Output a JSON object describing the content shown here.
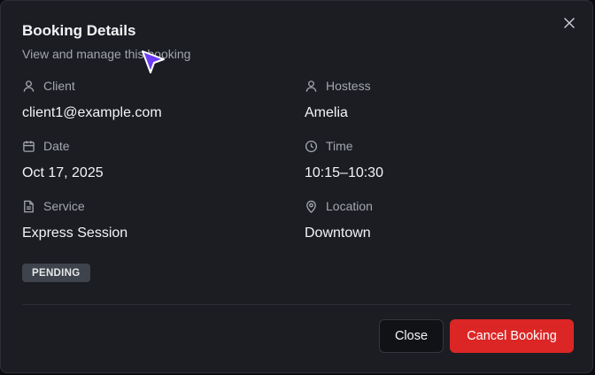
{
  "dialog": {
    "title": "Booking Details",
    "subtitle": "View and manage this booking",
    "close_icon": "x-icon"
  },
  "fields": {
    "client": {
      "label": "Client",
      "value": "client1@example.com",
      "icon": "user-icon"
    },
    "hostess": {
      "label": "Hostess",
      "value": "Amelia",
      "icon": "user-icon"
    },
    "date": {
      "label": "Date",
      "value": "Oct 17, 2025",
      "icon": "calendar-icon"
    },
    "time": {
      "label": "Time",
      "value": "10:15–10:30",
      "icon": "clock-icon"
    },
    "service": {
      "label": "Service",
      "value": "Express Session",
      "icon": "file-text-icon"
    },
    "location": {
      "label": "Location",
      "value": "Downtown",
      "icon": "map-pin-icon"
    }
  },
  "status": {
    "label": "PENDING"
  },
  "actions": {
    "close_label": "Close",
    "cancel_label": "Cancel Booking"
  },
  "colors": {
    "background": "#1b1d22",
    "danger": "#dc2626",
    "badge_bg": "#3f434b",
    "cursor": "#6d3cf5"
  }
}
